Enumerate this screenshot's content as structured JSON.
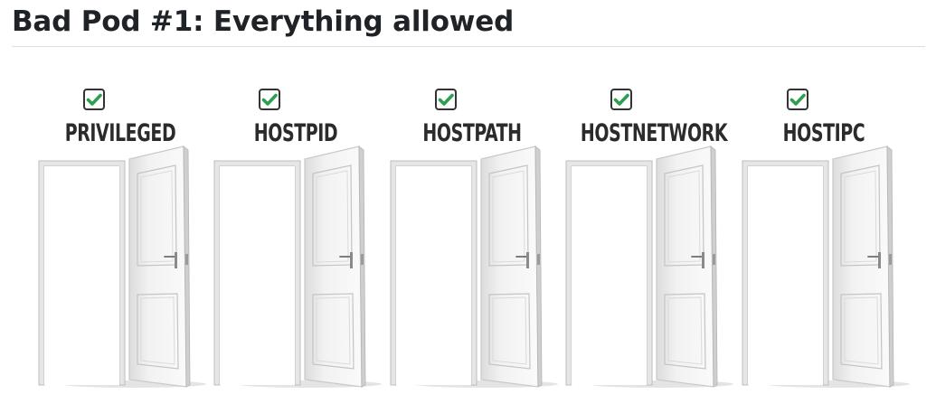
{
  "page": {
    "title": "Bad Pod #1: Everything allowed"
  },
  "figure": {
    "doors": [
      {
        "label": "PRIVILEGED",
        "checked": true,
        "icon": "checkbox-checked-icon"
      },
      {
        "label": "HOSTPID",
        "checked": true,
        "icon": "checkbox-checked-icon"
      },
      {
        "label": "HOSTPATH",
        "checked": true,
        "icon": "checkbox-checked-icon"
      },
      {
        "label": "HOSTNETWORK",
        "checked": true,
        "icon": "checkbox-checked-icon"
      },
      {
        "label": "HOSTIPC",
        "checked": true,
        "icon": "checkbox-checked-icon"
      }
    ],
    "colors": {
      "check": "#2e9e4f",
      "checkbox_border": "#333333",
      "door": "#f2f2f2",
      "door_shadow": "#c9c9c9",
      "frame": "#e6e6e6",
      "label": "#2b2b2b"
    }
  }
}
